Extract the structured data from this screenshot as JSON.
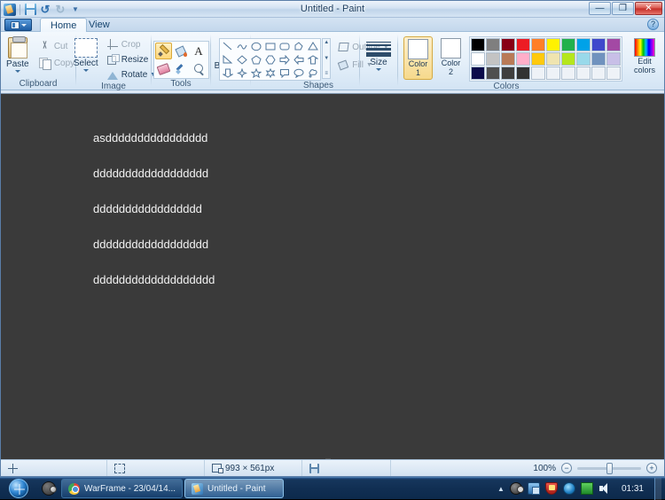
{
  "window": {
    "title": "Untitled - Paint",
    "quick_access": [
      {
        "name": "paint-logo",
        "label": "Paint"
      },
      {
        "name": "save-icon",
        "label": "Save"
      },
      {
        "name": "undo-icon",
        "label": "Undo"
      },
      {
        "name": "redo-icon",
        "label": "Redo"
      },
      {
        "name": "customize-qat-icon",
        "label": "Customize Quick Access Toolbar"
      }
    ],
    "controls": {
      "minimize": "—",
      "maximize": "❐",
      "close": "✕"
    },
    "help_label": "?"
  },
  "ribbon": {
    "app_menu_label": "File",
    "tabs": [
      {
        "label": "Home",
        "active": true
      },
      {
        "label": "View",
        "active": false
      }
    ],
    "groups": [
      {
        "label": "Clipboard",
        "items": [
          {
            "label": "Paste",
            "icon": "paste-icon",
            "has_dropdown": true
          },
          {
            "label": "Cut",
            "icon": "cut-icon",
            "disabled": true
          },
          {
            "label": "Copy",
            "icon": "copy-icon",
            "disabled": true
          }
        ]
      },
      {
        "label": "Image",
        "items": [
          {
            "label": "Select",
            "icon": "select-icon",
            "has_dropdown": true
          },
          {
            "label": "Crop",
            "icon": "crop-icon",
            "disabled": true
          },
          {
            "label": "Resize",
            "icon": "resize-icon"
          },
          {
            "label": "Rotate",
            "icon": "rotate-icon",
            "has_dropdown": true
          }
        ]
      },
      {
        "label": "Tools",
        "items": [
          {
            "label": "Pencil",
            "icon": "pencil-icon",
            "selected": true
          },
          {
            "label": "Fill with color",
            "icon": "fill-icon"
          },
          {
            "label": "Text",
            "icon": "text-icon"
          },
          {
            "label": "Eraser",
            "icon": "eraser-icon"
          },
          {
            "label": "Color picker",
            "icon": "color-picker-icon"
          },
          {
            "label": "Magnifier",
            "icon": "magnifier-icon"
          }
        ]
      },
      {
        "label": "",
        "items": [
          {
            "label": "Brushes",
            "icon": "brushes-icon",
            "has_dropdown": true
          }
        ]
      },
      {
        "label": "Shapes",
        "items": [
          {
            "label": "Line",
            "icon": "shape-line-icon"
          },
          {
            "label": "Curve",
            "icon": "shape-curve-icon"
          },
          {
            "label": "Oval",
            "icon": "shape-oval-icon"
          },
          {
            "label": "Rectangle",
            "icon": "shape-rectangle-icon"
          },
          {
            "label": "Rounded rectangle",
            "icon": "shape-rounded-rectangle-icon"
          },
          {
            "label": "Polygon",
            "icon": "shape-polygon-icon"
          },
          {
            "label": "Triangle",
            "icon": "shape-triangle-icon"
          },
          {
            "label": "Right triangle",
            "icon": "shape-right-triangle-icon"
          },
          {
            "label": "Diamond",
            "icon": "shape-diamond-icon"
          },
          {
            "label": "Pentagon",
            "icon": "shape-pentagon-icon"
          },
          {
            "label": "Hexagon",
            "icon": "shape-hexagon-icon"
          },
          {
            "label": "Right arrow",
            "icon": "shape-right-arrow-icon"
          },
          {
            "label": "Left arrow",
            "icon": "shape-left-arrow-icon"
          },
          {
            "label": "Up arrow",
            "icon": "shape-up-arrow-icon"
          },
          {
            "label": "Down arrow",
            "icon": "shape-down-arrow-icon"
          },
          {
            "label": "Four-point star",
            "icon": "shape-four-point-star-icon"
          },
          {
            "label": "Five-point star",
            "icon": "shape-five-point-star-icon"
          },
          {
            "label": "Six-point star",
            "icon": "shape-six-point-star-icon"
          },
          {
            "label": "Rounded rectangular callout",
            "icon": "shape-rect-callout-icon"
          },
          {
            "label": "Oval callout",
            "icon": "shape-oval-callout-icon"
          },
          {
            "label": "Cloud callout",
            "icon": "shape-cloud-callout-icon"
          }
        ],
        "scroll": {
          "up": "▲",
          "more": "▼",
          "expand": "≡"
        },
        "outline_label": "Outline",
        "fill_label": "Fill"
      },
      {
        "label": "",
        "items": [
          {
            "label": "Size",
            "icon": "size-icon",
            "has_dropdown": true
          }
        ]
      },
      {
        "label": "Colors",
        "color1_label_line1": "Color",
        "color1_label_line2": "1",
        "color2_label_line1": "Color",
        "color2_label_line2": "2",
        "color1_value": "#ffffff",
        "color2_value": "#ffffff",
        "edit_colors_label_line1": "Edit",
        "edit_colors_label_line2": "colors",
        "palette_rows": [
          [
            "#000000",
            "#7f7f7f",
            "#880015",
            "#ed1c24",
            "#ff7f27",
            "#fff200",
            "#22b14c",
            "#00a2e8",
            "#3f48cc",
            "#a349a4"
          ],
          [
            "#ffffff",
            "#c3c3c3",
            "#b97a57",
            "#ffaec9",
            "#ffc90e",
            "#efe4b0",
            "#b5e61d",
            "#99d9ea",
            "#7092be",
            "#c8bfe7"
          ],
          [
            "#0b0b4a",
            "#4f4f4f",
            "#3f3f3f",
            "#323232",
            "#eef2f7",
            "#eef2f7",
            "#eef2f7",
            "#eef2f7",
            "#eef2f7",
            "#eef2f7"
          ]
        ]
      }
    ]
  },
  "canvas": {
    "background_color": "#3a3a3a",
    "text_color": "#f2f2f2",
    "lines": [
      "asdddddddddddddddd",
      "dddddddddddddddddd",
      "ddddddddddddddddd",
      "dddddddddddddddddd",
      "ddddddddddddddddddd"
    ]
  },
  "statusbar": {
    "cursor_position": "",
    "selection_size": "",
    "image_size": "993 × 561px",
    "file_size": "",
    "zoom_level": "100%",
    "zoom_out": "−",
    "zoom_in": "+"
  },
  "taskbar": {
    "start_label": "Start",
    "quick_launch": [
      {
        "name": "steam-icon",
        "label": "Steam"
      }
    ],
    "items": [
      {
        "label": "WarFrame - 23/04/14...",
        "icon": "chrome-icon",
        "active": false
      },
      {
        "label": "Untitled - Paint",
        "icon": "paint-icon",
        "active": true
      }
    ],
    "tray": [
      {
        "name": "show-hidden-icons-caret",
        "label": "Show hidden icons"
      },
      {
        "name": "steam-tray-icon",
        "label": "Steam"
      },
      {
        "name": "network-icon",
        "label": "Network"
      },
      {
        "name": "security-shield-icon",
        "label": "Action Center"
      },
      {
        "name": "firefox-icon",
        "label": "Firefox"
      },
      {
        "name": "green-status-icon",
        "label": "Status"
      },
      {
        "name": "volume-icon",
        "label": "Volume"
      }
    ],
    "clock": "01:31"
  }
}
